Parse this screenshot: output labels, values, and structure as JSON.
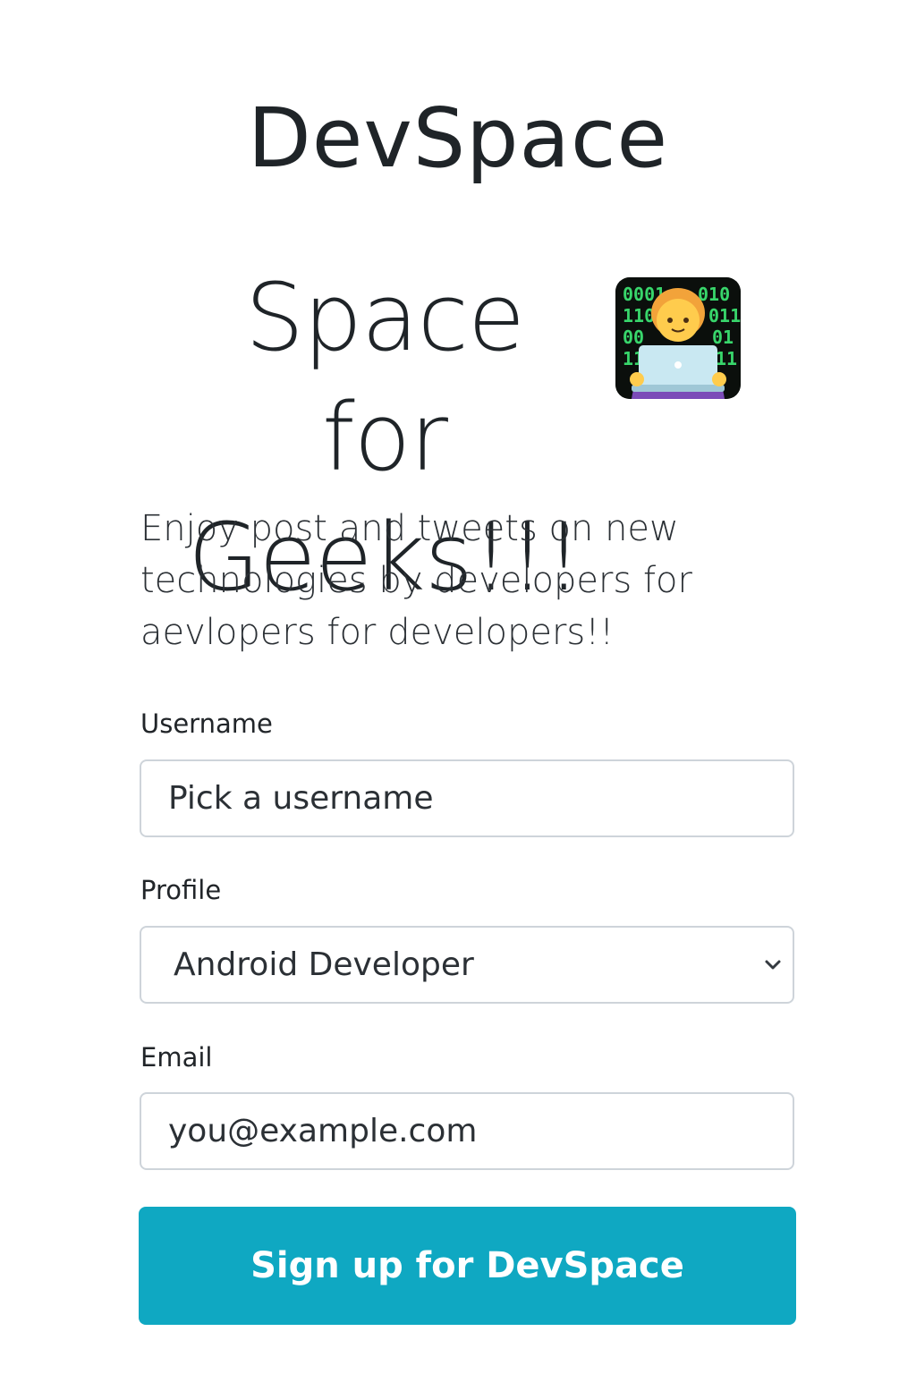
{
  "brand": {
    "name": "DevSpace"
  },
  "hero": {
    "title_line1": "Space for",
    "title_line2": "Geeks!!!",
    "emoji_icon": "technologist-emoji-icon",
    "tagline": "Enjoy post and tweets on new technologies by developers for aevlopers for developers!!"
  },
  "form": {
    "username": {
      "label": "Username",
      "placeholder": "Pick a username",
      "value": ""
    },
    "profile": {
      "label": "Profile",
      "selected": "Android Developer",
      "icon": "chevron-down-icon"
    },
    "email": {
      "label": "Email",
      "placeholder": "you@example.com",
      "value": ""
    },
    "submit_label": "Sign up for DevSpace"
  },
  "colors": {
    "primary_button": "#0fa8c2",
    "input_border": "#ced4da",
    "text": "#212529"
  }
}
